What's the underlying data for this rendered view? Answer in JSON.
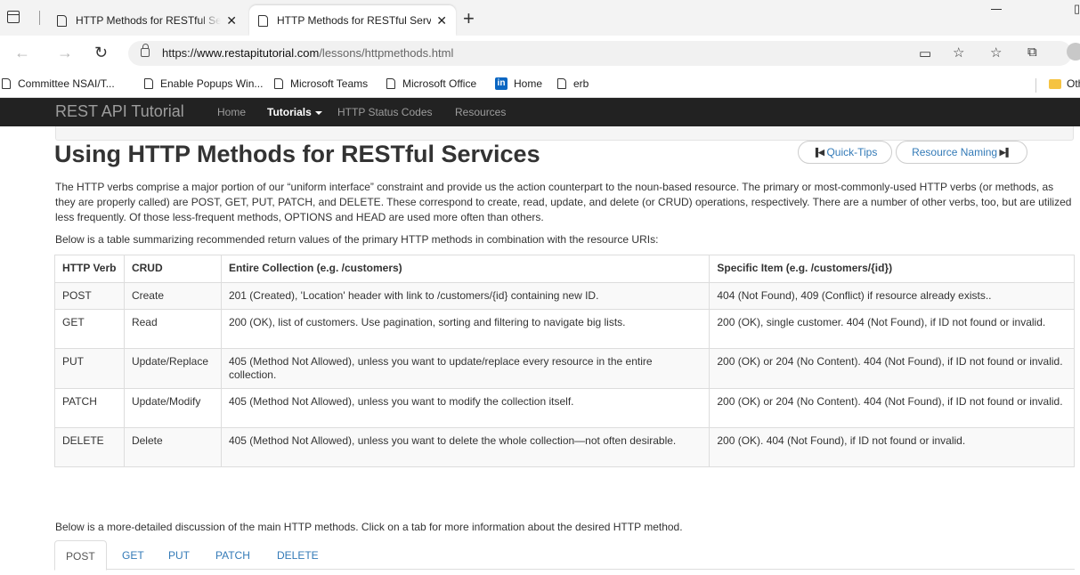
{
  "browser": {
    "tabs": [
      {
        "title": "HTTP Methods for RESTful Services",
        "close": "✕"
      },
      {
        "title": "HTTP Methods for RESTful Services",
        "close": "✕"
      }
    ],
    "new_tab": "+",
    "url_prefix": "https://",
    "url_host": "www.restapitutorial.com",
    "url_path": "/lessons/httpmethods.html",
    "bookmarks": [
      {
        "label": "Committee NSAI/T..."
      },
      {
        "label": "Enable Popups Win..."
      },
      {
        "label": "Microsoft Teams"
      },
      {
        "label": "Microsoft Office"
      },
      {
        "label": "Home",
        "icon": "in"
      },
      {
        "label": "erb"
      }
    ],
    "other_bookmarks": "Other"
  },
  "site": {
    "brand": "REST API Tutorial",
    "nav": {
      "home": "Home",
      "tutorials": "Tutorials",
      "status_codes": "HTTP Status Codes",
      "resources": "Resources"
    }
  },
  "page": {
    "title": "Using HTTP Methods for RESTful Services",
    "prev_button": "Quick-Tips",
    "next_button": "Resource Naming",
    "intro": "The HTTP verbs comprise a major portion of our “uniform interface” constraint and provide us the action counterpart to the noun-based resource. The primary or most-commonly-used HTTP verbs (or methods, as they are properly called) are POST, GET, PUT, PATCH, and DELETE. These correspond to create, read, update, and delete (or CRUD) operations, respectively. There are a number of other verbs, too, but are utilized less frequently. Of those less-frequent methods, OPTIONS and HEAD are used more often than others.",
    "table_lead": "Below is a table summarizing recommended return values of the primary HTTP methods in combination with the resource URIs:",
    "table": {
      "headers": [
        "HTTP Verb",
        "CRUD",
        "Entire Collection (e.g. /customers)",
        "Specific Item (e.g. /customers/{id})"
      ],
      "rows": [
        [
          "POST",
          "Create",
          "201 (Created), 'Location' header with link to /customers/{id} containing new ID.",
          "404 (Not Found), 409 (Conflict) if resource already exists.."
        ],
        [
          "GET",
          "Read",
          "200 (OK), list of customers. Use pagination, sorting and filtering to navigate big lists.",
          "200 (OK), single customer. 404 (Not Found), if ID not found or invalid."
        ],
        [
          "PUT",
          "Update/Replace",
          "405 (Method Not Allowed), unless you want to update/replace every resource in the entire collection.",
          "200 (OK) or 204 (No Content). 404 (Not Found), if ID not found or invalid."
        ],
        [
          "PATCH",
          "Update/Modify",
          "405 (Method Not Allowed), unless you want to modify the collection itself.",
          "200 (OK) or 204 (No Content). 404 (Not Found), if ID not found or invalid."
        ],
        [
          "DELETE",
          "Delete",
          "405 (Method Not Allowed), unless you want to delete the whole collection—not often desirable.",
          "200 (OK). 404 (Not Found), if ID not found or invalid."
        ]
      ]
    },
    "detail_lead": "Below is a more-detailed discussion of the main HTTP methods. Click on a tab for more information about the desired HTTP method.",
    "method_tabs": [
      "POST",
      "GET",
      "PUT",
      "PATCH",
      "DELETE"
    ],
    "active_tab": "POST"
  },
  "colors": {
    "navbar_bg": "#222222",
    "link": "#337ab7",
    "table_stripe": "#f9f9f9"
  }
}
